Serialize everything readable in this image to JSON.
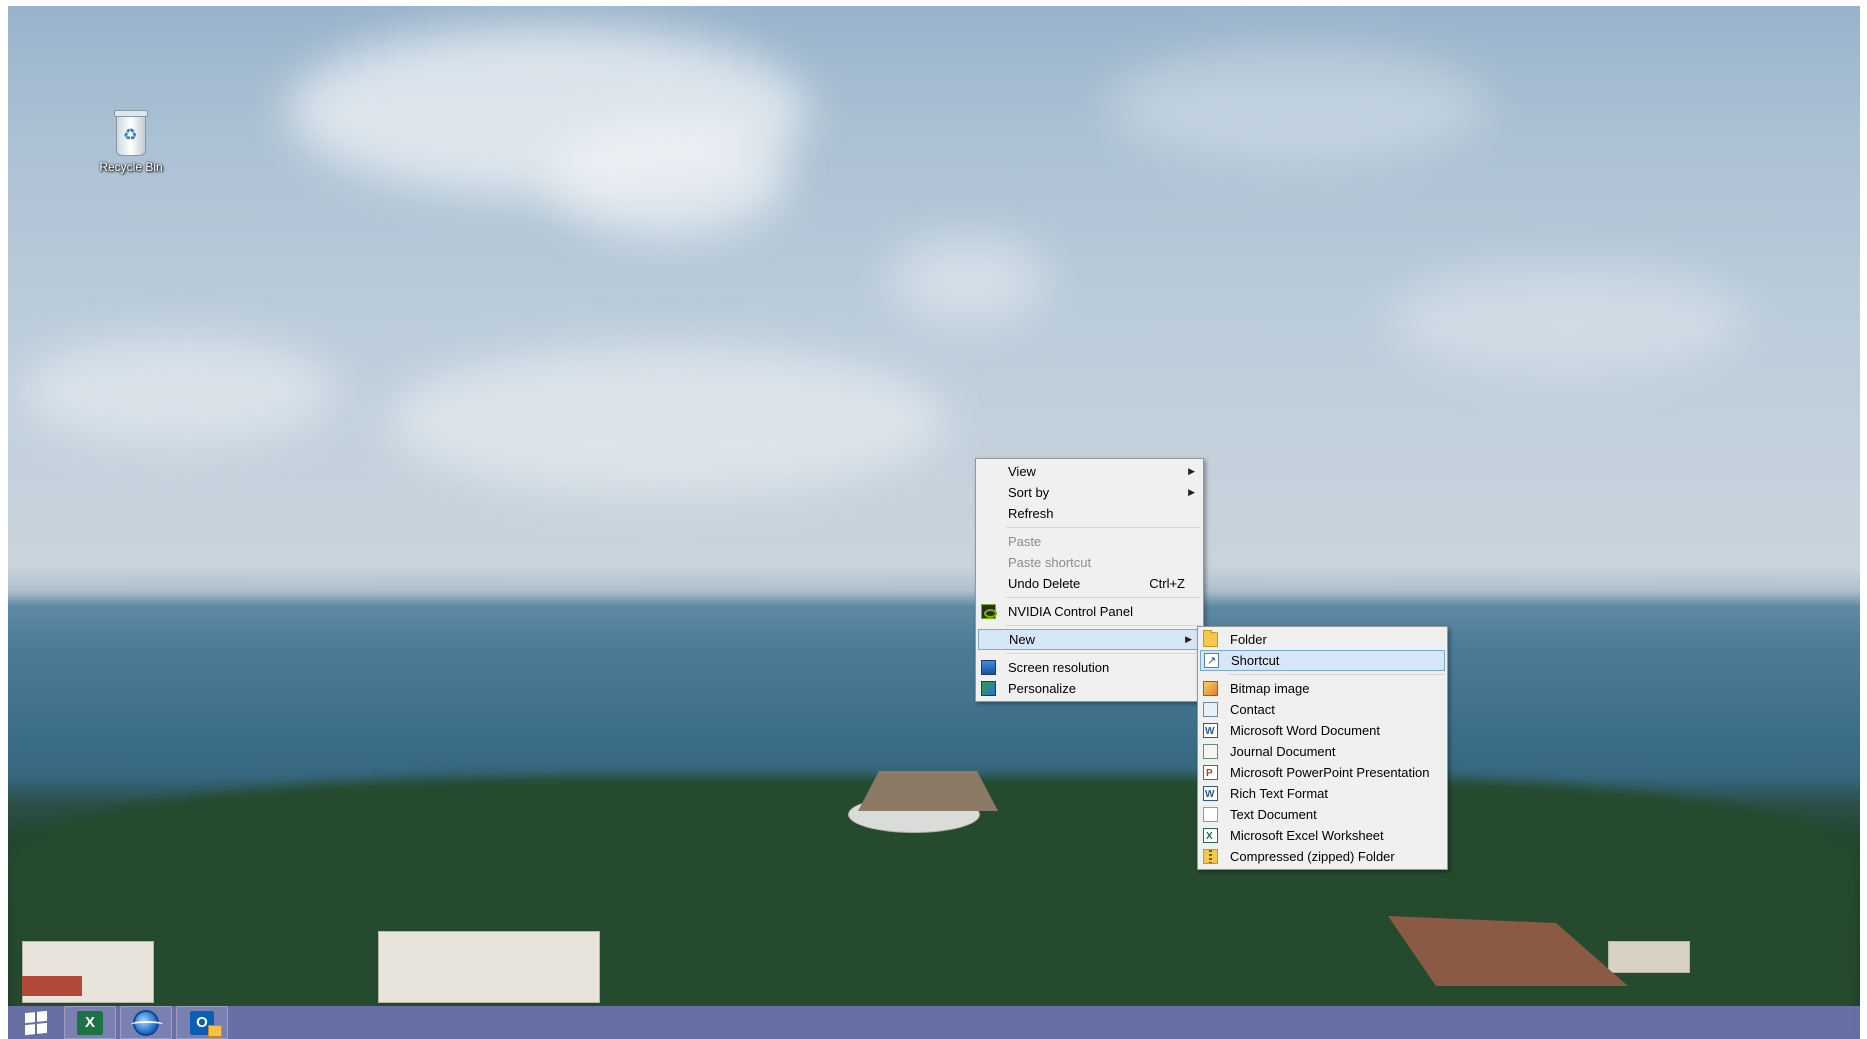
{
  "desktop": {
    "recycle_bin_label": "Recycle Bin"
  },
  "taskbar": {
    "items": [
      {
        "icon": "windows-start-icon"
      },
      {
        "icon": "excel-icon"
      },
      {
        "icon": "internet-explorer-icon"
      },
      {
        "icon": "outlook-icon"
      }
    ],
    "color": "#7878be"
  },
  "context_menu": {
    "view": "View",
    "sort_by": "Sort by",
    "refresh": "Refresh",
    "paste": "Paste",
    "paste_shortcut": "Paste shortcut",
    "undo_delete": "Undo Delete",
    "undo_shortcut": "Ctrl+Z",
    "nvidia": "NVIDIA Control Panel",
    "new": "New",
    "screen_resolution": "Screen resolution",
    "personalize": "Personalize"
  },
  "new_submenu": {
    "folder": "Folder",
    "shortcut": "Shortcut",
    "bitmap": "Bitmap image",
    "contact": "Contact",
    "word": "Microsoft Word Document",
    "journal": "Journal Document",
    "powerpoint": "Microsoft PowerPoint Presentation",
    "rtf": "Rich Text Format",
    "text": "Text Document",
    "excel": "Microsoft Excel Worksheet",
    "zip": "Compressed (zipped) Folder"
  },
  "colors": {
    "menu_bg": "#f0f0f0",
    "highlight": "#d5e6f7"
  }
}
